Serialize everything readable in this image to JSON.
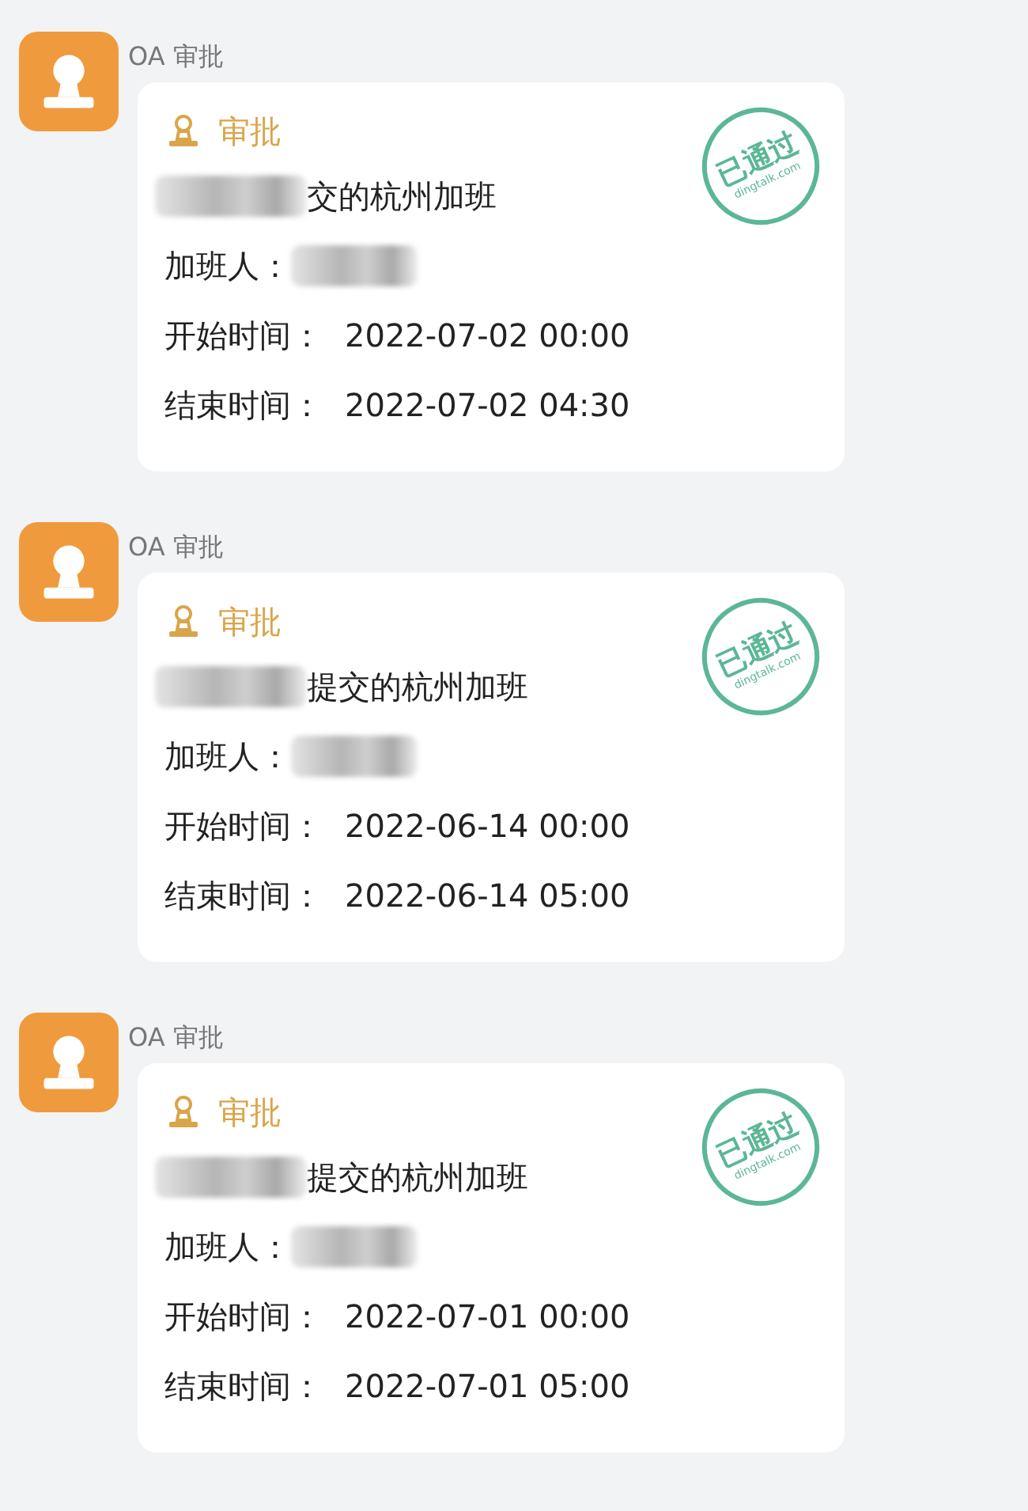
{
  "messages": [
    {
      "sender": "OA 审批",
      "card": {
        "header": "审批",
        "title": {
          "text": "交的杭州加班",
          "prefix_blurred": true
        },
        "stamp": {
          "text": "已通过",
          "domain": "dingtalk.com"
        },
        "fields": [
          {
            "label": "加班人：",
            "value_blurred": true
          },
          {
            "label": "开始时间：",
            "value": "2022-07-02 00:00"
          },
          {
            "label": "结束时间：",
            "value": "2022-07-02 04:30"
          }
        ]
      }
    },
    {
      "sender": "OA 审批",
      "card": {
        "header": "审批",
        "title": {
          "text": "提交的杭州加班",
          "prefix_blurred": true
        },
        "stamp": {
          "text": "已通过",
          "domain": "dingtalk.com"
        },
        "fields": [
          {
            "label": "加班人：",
            "value_blurred": true
          },
          {
            "label": "开始时间：",
            "value": "2022-06-14 00:00"
          },
          {
            "label": "结束时间：",
            "value": "2022-06-14 05:00"
          }
        ]
      }
    },
    {
      "sender": "OA 审批",
      "card": {
        "header": "审批",
        "title": {
          "text": "提交的杭州加班",
          "prefix_blurred": true
        },
        "stamp": {
          "text": "已通过",
          "domain": "dingtalk.com"
        },
        "fields": [
          {
            "label": "加班人：",
            "value_blurred": true
          },
          {
            "label": "开始时间：",
            "value": "2022-07-01 00:00"
          },
          {
            "label": "结束时间：",
            "value": "2022-07-01 05:00"
          }
        ]
      }
    }
  ]
}
